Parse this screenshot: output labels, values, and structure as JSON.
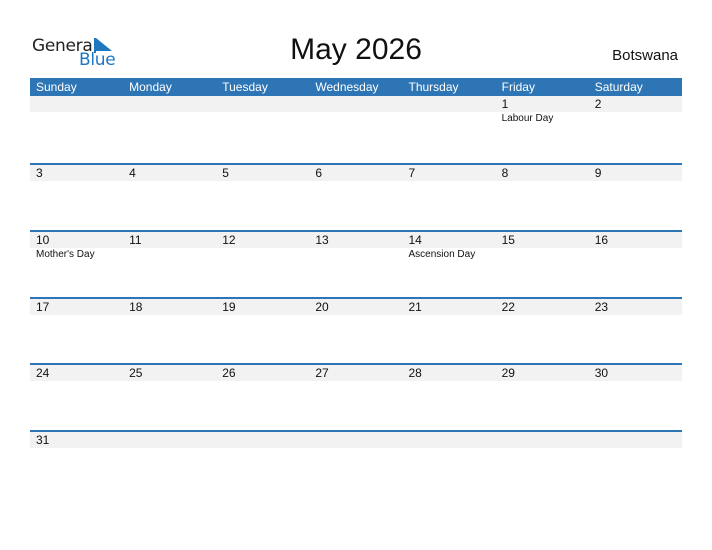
{
  "logo": {
    "word1": "General",
    "word2": "Blue"
  },
  "header": {
    "title": "May 2026",
    "country": "Botswana"
  },
  "colors": {
    "accent": "#2e75b5",
    "date_strip": "#f2f2f2",
    "logo_blue": "#1f77c0"
  },
  "weekdays": [
    "Sunday",
    "Monday",
    "Tuesday",
    "Wednesday",
    "Thursday",
    "Friday",
    "Saturday"
  ],
  "weeks": [
    [
      {
        "day": "",
        "event": ""
      },
      {
        "day": "",
        "event": ""
      },
      {
        "day": "",
        "event": ""
      },
      {
        "day": "",
        "event": ""
      },
      {
        "day": "",
        "event": ""
      },
      {
        "day": "1",
        "event": "Labour Day"
      },
      {
        "day": "2",
        "event": ""
      }
    ],
    [
      {
        "day": "3",
        "event": ""
      },
      {
        "day": "4",
        "event": ""
      },
      {
        "day": "5",
        "event": ""
      },
      {
        "day": "6",
        "event": ""
      },
      {
        "day": "7",
        "event": ""
      },
      {
        "day": "8",
        "event": ""
      },
      {
        "day": "9",
        "event": ""
      }
    ],
    [
      {
        "day": "10",
        "event": "Mother's Day"
      },
      {
        "day": "11",
        "event": ""
      },
      {
        "day": "12",
        "event": ""
      },
      {
        "day": "13",
        "event": ""
      },
      {
        "day": "14",
        "event": "Ascension Day"
      },
      {
        "day": "15",
        "event": ""
      },
      {
        "day": "16",
        "event": ""
      }
    ],
    [
      {
        "day": "17",
        "event": ""
      },
      {
        "day": "18",
        "event": ""
      },
      {
        "day": "19",
        "event": ""
      },
      {
        "day": "20",
        "event": ""
      },
      {
        "day": "21",
        "event": ""
      },
      {
        "day": "22",
        "event": ""
      },
      {
        "day": "23",
        "event": ""
      }
    ],
    [
      {
        "day": "24",
        "event": ""
      },
      {
        "day": "25",
        "event": ""
      },
      {
        "day": "26",
        "event": ""
      },
      {
        "day": "27",
        "event": ""
      },
      {
        "day": "28",
        "event": ""
      },
      {
        "day": "29",
        "event": ""
      },
      {
        "day": "30",
        "event": ""
      }
    ],
    [
      {
        "day": "31",
        "event": ""
      },
      {
        "day": "",
        "event": ""
      },
      {
        "day": "",
        "event": ""
      },
      {
        "day": "",
        "event": ""
      },
      {
        "day": "",
        "event": ""
      },
      {
        "day": "",
        "event": ""
      },
      {
        "day": "",
        "event": ""
      }
    ]
  ]
}
